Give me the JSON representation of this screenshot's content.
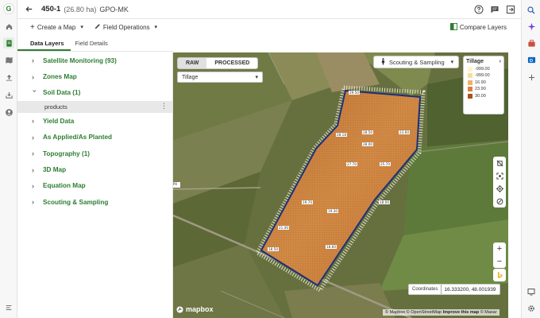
{
  "header": {
    "field_name": "450-1",
    "field_area": "(26.80 ha)",
    "farm": "GPO-MK"
  },
  "toolbar": {
    "create_map": "Create a Map",
    "field_operations": "Field Operations",
    "compare_layers": "Compare Layers"
  },
  "tabs": [
    "Data Layers",
    "Field Details"
  ],
  "layers": [
    {
      "label": "Satellite Monitoring (93)"
    },
    {
      "label": "Zones Map"
    },
    {
      "label": "Soil Data (1)",
      "expanded": true
    },
    {
      "label": "Yield Data"
    },
    {
      "label": "As Applied/As Planted"
    },
    {
      "label": "Topography (1)"
    },
    {
      "label": "3D Map"
    },
    {
      "label": "Equation Map"
    },
    {
      "label": "Scouting & Sampling"
    }
  ],
  "soil_sublayer": "products",
  "map": {
    "raw_label": "RAW",
    "processed_label": "PROCESSED",
    "attribute": "Tillage",
    "scouting": "Scouting & Sampling",
    "legend_title": "Tillage",
    "legend": [
      {
        "value": "-999.00",
        "color": "#fdf3d2"
      },
      {
        "value": "-999.00",
        "color": "#f8dca0"
      },
      {
        "value": "16.90",
        "color": "#eeb16a"
      },
      {
        "value": "23.90",
        "color": "#db8238"
      },
      {
        "value": "30.00",
        "color": "#a8531d"
      }
    ],
    "value_labels": [
      "29.50",
      "28.18",
      "28.50",
      "23.60",
      "28.00",
      "27.70",
      "25.70",
      "19.70",
      "19.30",
      "18.00",
      "21.40",
      "18.60",
      "18.50"
    ],
    "coordinates_label": "Coordinates",
    "coordinates_value": "16.333200, 48.001939",
    "attribution_osm": "© Mapbox © OpenStreetMap",
    "attribution_improve": "Improve this map",
    "attribution_maxar": "© Maxar",
    "mapbox_logo": "mapbox",
    "edge_label": "P4"
  }
}
